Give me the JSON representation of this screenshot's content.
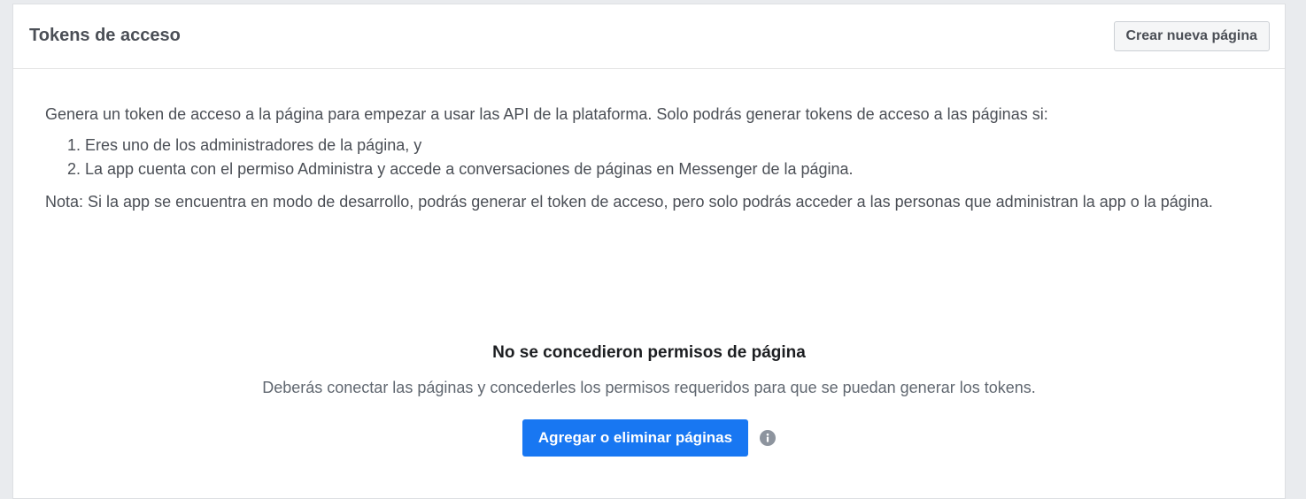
{
  "header": {
    "title": "Tokens de acceso",
    "create_page_label": "Crear nueva página"
  },
  "content": {
    "intro": "Genera un token de acceso a la página para empezar a usar las API de la plataforma. Solo podrás generar tokens de acceso a las páginas si:",
    "requirements": [
      "Eres uno de los administradores de la página, y",
      "La app cuenta con el permiso Administra y accede a conversaciones de páginas en Messenger de la página."
    ],
    "note": "Nota: Si la app se encuentra en modo de desarrollo, podrás generar el token de acceso, pero solo podrás acceder a las personas que administran la app o la página."
  },
  "empty_state": {
    "title": "No se concedieron permisos de página",
    "description": "Deberás conectar las páginas y concederles los permisos requeridos para que se puedan generar los tokens.",
    "button_label": "Agregar o eliminar páginas",
    "info_icon": "info-icon"
  },
  "colors": {
    "primary": "#1877f2",
    "background": "#e9ebee",
    "text": "#4b4f56"
  }
}
